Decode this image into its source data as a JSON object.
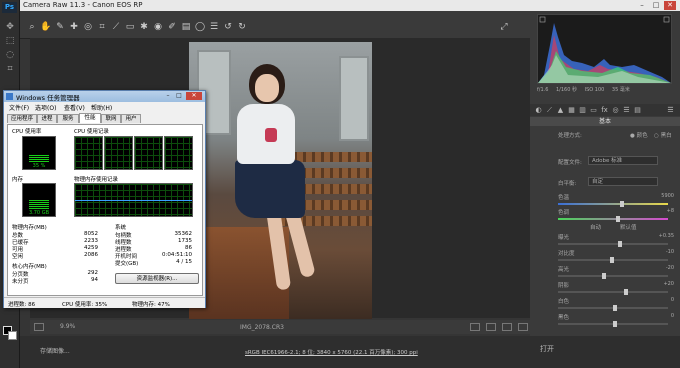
{
  "photoshop": {
    "logo": "Ps",
    "tools": [
      "move-icon",
      "marquee-icon",
      "lasso-icon"
    ],
    "foreground_color": "#000000",
    "background_color": "#ffffff"
  },
  "camera_raw": {
    "title": "Camera Raw 11.3  -  Canon EOS RP",
    "zoom": "9.9%",
    "filename": "IMG_2078.CR3",
    "workflow": "sRGB IEC61966-2.1; 8 位; 3840 x 5760 (22.1 百万像素); 300 ppi",
    "save_label": "存储图像...",
    "open_label": "打开",
    "exif": [
      "f/1.6",
      "1/160 秒",
      "ISO 100",
      "35 毫米"
    ],
    "panel_title": "基本",
    "treatment_label": "处理方式:",
    "treatment_color": "颜色",
    "treatment_bw": "黑白",
    "profile_label": "配置文件:",
    "profile_value": "Adobe 标准",
    "wb_label": "白平衡:",
    "wb_value": "自定",
    "sliders": [
      {
        "label": "色温",
        "value": "5900"
      },
      {
        "label": "色调",
        "value": "+8"
      },
      {
        "label": "曝光",
        "value": "+0.35"
      },
      {
        "label": "对比度",
        "value": "-10"
      },
      {
        "label": "高光",
        "value": "-20"
      },
      {
        "label": "阴影",
        "value": "+20"
      },
      {
        "label": "白色",
        "value": "0"
      },
      {
        "label": "黑色",
        "value": "0"
      }
    ],
    "auto_label": "自动",
    "default_label": "默认值"
  },
  "task_manager": {
    "title": "Windows 任务管理器",
    "menu": [
      "文件(F)",
      "选项(O)",
      "查看(V)",
      "帮助(H)"
    ],
    "tabs": [
      "应用程序",
      "进程",
      "服务",
      "性能",
      "联网",
      "用户"
    ],
    "active_tab": "性能",
    "cpu_usage_label": "CPU 使用率",
    "cpu_history_label": "CPU 使用记录",
    "cpu_value": "35 %",
    "cpu_fraction": 0.35,
    "mem_label": "内存",
    "mem_history_label": "物理内存使用记录",
    "mem_value": "3.70 GB",
    "mem_fraction": 0.47,
    "physical_memory": {
      "title": "物理内存(MB)",
      "rows": [
        {
          "label": "总数",
          "value": "8052"
        },
        {
          "label": "已缓存",
          "value": "2233"
        },
        {
          "label": "可用",
          "value": "4259"
        },
        {
          "label": "空闲",
          "value": "2086"
        }
      ]
    },
    "system": {
      "title": "系统",
      "rows": [
        {
          "label": "句柄数",
          "value": "35362"
        },
        {
          "label": "线程数",
          "value": "1735"
        },
        {
          "label": "进程数",
          "value": "86"
        },
        {
          "label": "开机时间",
          "value": "0:04:51:10"
        },
        {
          "label": "提交(GB)",
          "value": "4 / 15"
        }
      ]
    },
    "kernel_memory": {
      "title": "核心内存(MB)",
      "rows": [
        {
          "label": "分页数",
          "value": "292"
        },
        {
          "label": "未分页",
          "value": "94"
        }
      ]
    },
    "resmon_label": "资源监视器(R)...",
    "status_processes": "进程数: 86",
    "status_cpu": "CPU 使用率: 35%",
    "status_memory": "物理内存: 47%"
  }
}
